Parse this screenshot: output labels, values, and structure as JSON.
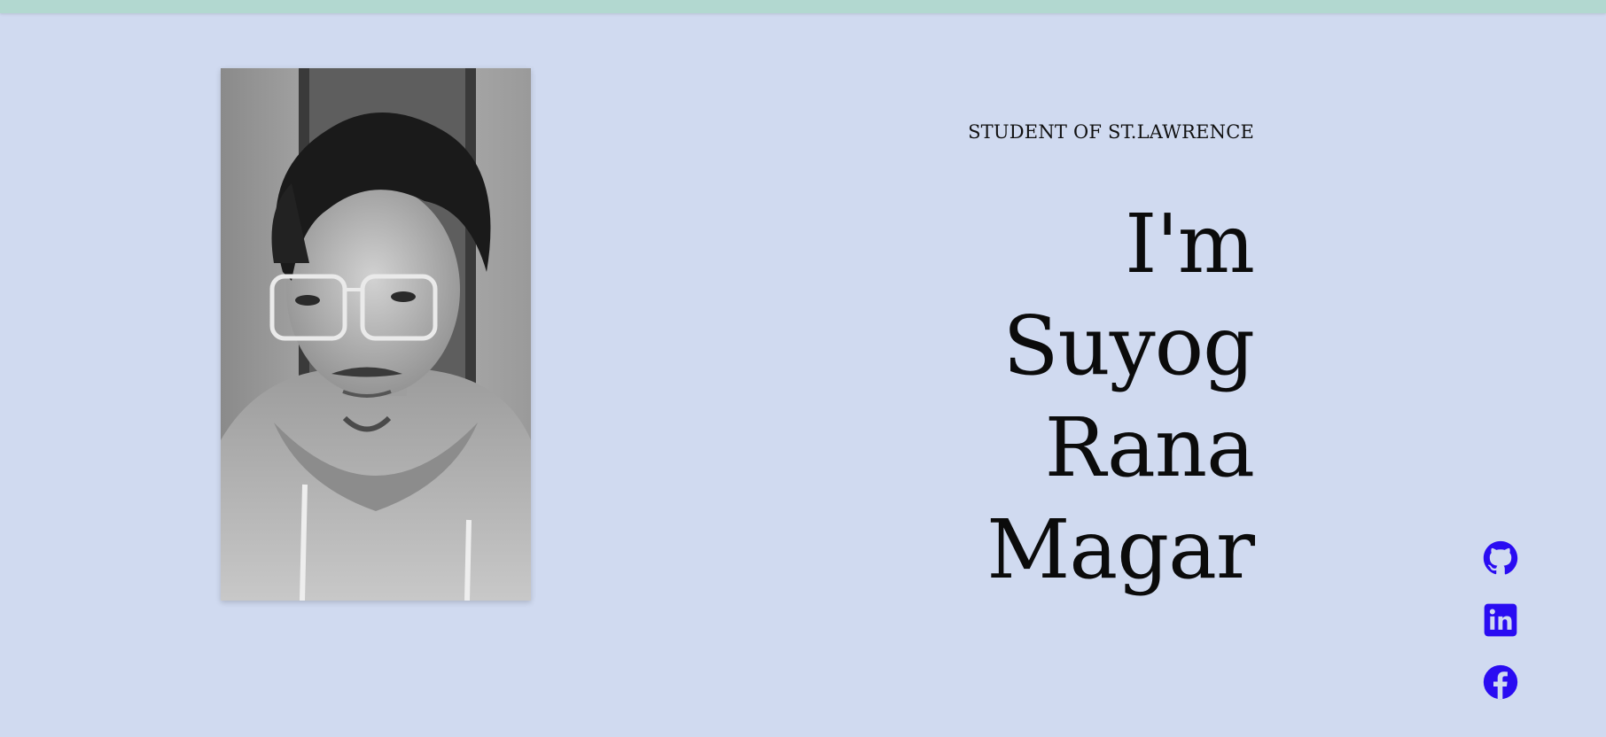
{
  "hero": {
    "subtitle": "STUDENT OF ST.LAWRENCE",
    "name_lines": [
      "I'm",
      "Suyog",
      "Rana",
      "Magar"
    ]
  },
  "portrait": {
    "icon": "portrait-photo"
  },
  "socials": [
    {
      "icon": "github-icon"
    },
    {
      "icon": "linkedin-icon"
    },
    {
      "icon": "facebook-icon"
    }
  ],
  "colors": {
    "background": "#d0daf0",
    "top_bar": "#b2d8d0",
    "social_icon": "#2a0cf2",
    "text": "#0b0b0b"
  }
}
